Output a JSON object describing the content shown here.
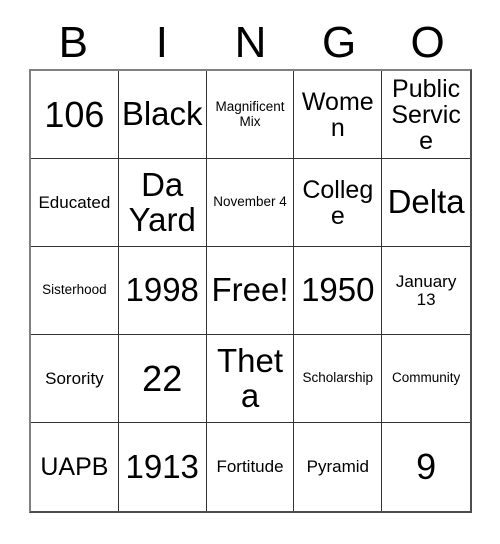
{
  "card": {
    "title": "BINGO",
    "headers": [
      "B",
      "I",
      "N",
      "G",
      "O"
    ],
    "colors": {
      "background": "#ffffff",
      "text": "#000000",
      "grid_line": "#333333",
      "outer_border": "#4d4d4d"
    },
    "grid_size": "5x5",
    "free_space": "Free!",
    "cells": [
      {
        "text": "106",
        "size": "fs-xl"
      },
      {
        "text": "Black",
        "size": "fs-lg"
      },
      {
        "text": "Magnificent Mix",
        "size": "fs-xs"
      },
      {
        "text": "Women",
        "size": "fs-md"
      },
      {
        "text": "Public Service",
        "size": "fs-md"
      },
      {
        "text": "Educated",
        "size": "fs-sm"
      },
      {
        "text": "Da Yard",
        "size": "fs-lg"
      },
      {
        "text": "November 4",
        "size": "fs-xs"
      },
      {
        "text": "College",
        "size": "fs-md"
      },
      {
        "text": "Delta",
        "size": "fs-lg"
      },
      {
        "text": "Sisterhood",
        "size": "fs-xs"
      },
      {
        "text": "1998",
        "size": "fs-lg"
      },
      {
        "text": "Free!",
        "size": "fs-lg"
      },
      {
        "text": "1950",
        "size": "fs-lg"
      },
      {
        "text": "January 13",
        "size": "fs-sm"
      },
      {
        "text": "Sorority",
        "size": "fs-sm"
      },
      {
        "text": "22",
        "size": "fs-xl"
      },
      {
        "text": "Theta",
        "size": "fs-lg"
      },
      {
        "text": "Scholarship",
        "size": "fs-xs"
      },
      {
        "text": "Community",
        "size": "fs-xs"
      },
      {
        "text": "UAPB",
        "size": "fs-md"
      },
      {
        "text": "1913",
        "size": "fs-lg"
      },
      {
        "text": "Fortitude",
        "size": "fs-sm"
      },
      {
        "text": "Pyramid",
        "size": "fs-sm"
      },
      {
        "text": "9",
        "size": "fs-xl"
      }
    ]
  }
}
